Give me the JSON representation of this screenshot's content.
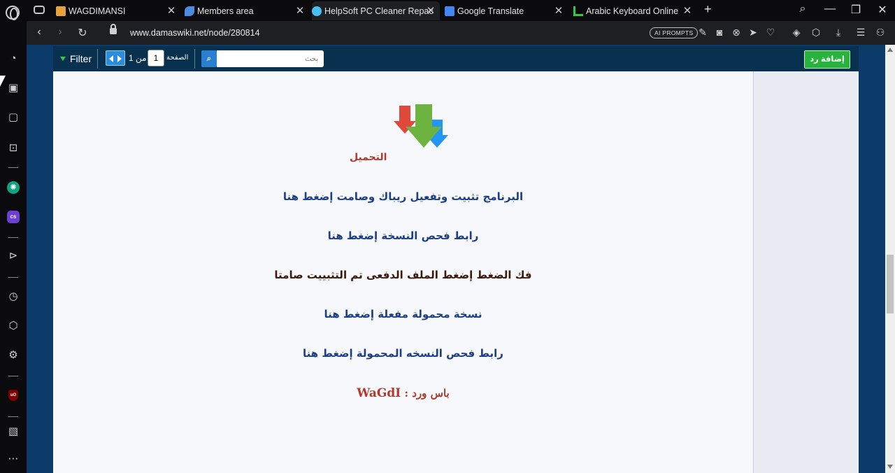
{
  "tabs": [
    {
      "title": "WAGDIMANSI",
      "favicon_color": "#e8a23a"
    },
    {
      "title": "Members area",
      "favicon_color": "#4a8be0"
    },
    {
      "title": "HelpSoft PC Cleaner Repac",
      "favicon_color": "#4ac0f0",
      "active": true
    },
    {
      "title": "Google Translate",
      "favicon_color": "#4285f4"
    },
    {
      "title": "Arabic Keyboard Online LE",
      "favicon_color": "#2ecc40"
    }
  ],
  "address": {
    "url": "www.damaswiki.net/node/280814",
    "ai_prompts": "AI PROMPTS"
  },
  "page": {
    "filter_label": "Filter",
    "page_total": "1 من",
    "page_current": "1",
    "page_label": "الصفحة",
    "search_placeholder": "بحث",
    "search_icon": "⌕",
    "reply_label": "إضافة رد",
    "download_label": "التحميل",
    "lines": [
      "البرنامج تثبيت وتفعيل ريباك وصامت إضغط هنا",
      "رابط فحص النسخة إضغط هنا",
      "فك الضغط إضغط الملف الدفعى تم التثبييت صامتا",
      "نسخة محمولة مفعلة إضغط هنا",
      "رابط فحص النسخه المحمولة إضغط هنا"
    ],
    "password_label": "باس ورد :",
    "password_value": "WaGdI"
  },
  "colors": {
    "arrow_red": "#e0483a",
    "arrow_green": "#6cb33f",
    "arrow_blue": "#2196f3",
    "link_blue": "#1d3f86",
    "accent_red": "#b0392b"
  }
}
